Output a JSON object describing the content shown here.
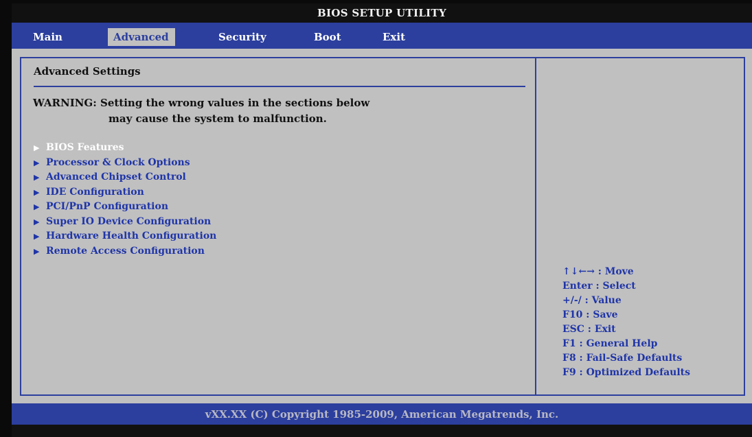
{
  "title": "BIOS SETUP UTILITY",
  "tabs": [
    {
      "label": "Main",
      "active": false
    },
    {
      "label": "Advanced",
      "active": true
    },
    {
      "label": "Security",
      "active": false
    },
    {
      "label": "Boot",
      "active": false
    },
    {
      "label": "Exit",
      "active": false
    }
  ],
  "section_title": "Advanced Settings",
  "warning": {
    "line1": "WARNING: Setting the wrong values in the sections below",
    "line2": "may cause the system to malfunction."
  },
  "menu_arrow": "▶",
  "menu_items": [
    {
      "label": "BIOS Features",
      "selected": true
    },
    {
      "label": "Processor & Clock Options",
      "selected": false
    },
    {
      "label": "Advanced Chipset Control",
      "selected": false
    },
    {
      "label": "IDE Configuration",
      "selected": false
    },
    {
      "label": "PCI/PnP Configuration",
      "selected": false
    },
    {
      "label": "Super IO Device Configuration",
      "selected": false
    },
    {
      "label": "Hardware Health Configuration",
      "selected": false
    },
    {
      "label": "Remote Access Configuration",
      "selected": false
    }
  ],
  "help": [
    "↑↓←→ : Move",
    "Enter : Select",
    "+/-/ : Value",
    "F10 : Save",
    "ESC : Exit",
    "F1 : General Help",
    "F8 : Fail-Safe Defaults",
    "F9 : Optimized Defaults"
  ],
  "footer": "vXX.XX (C) Copyright 1985-2009, American Megatrends, Inc.",
  "colors": {
    "accent_blue": "#2c3f9e",
    "background_gray": "#c0c0c0",
    "item_blue": "#1f35a8",
    "selected_text": "#ffffff"
  }
}
